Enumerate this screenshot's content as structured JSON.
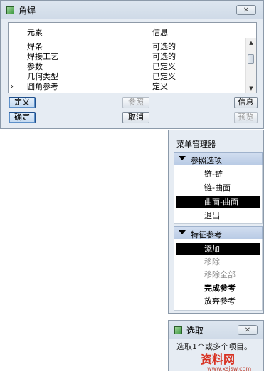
{
  "dialog": {
    "title": "角焊",
    "columns": [
      "元素",
      "信息"
    ],
    "rows": [
      {
        "element": "焊条",
        "info": "可选的",
        "marker": ""
      },
      {
        "element": "焊接工艺",
        "info": "可选的",
        "marker": ""
      },
      {
        "element": "参数",
        "info": "已定义",
        "marker": ""
      },
      {
        "element": "几何类型",
        "info": "已定义",
        "marker": ""
      },
      {
        "element": "圆角参考",
        "info": "定义",
        "marker": "›"
      }
    ],
    "buttons": {
      "define": "定义",
      "reference": "参照",
      "info": "信息",
      "ok": "确定",
      "cancel": "取消",
      "preview": "预览"
    },
    "close_glyph": "✕"
  },
  "menu_manager": {
    "title": "菜单管理器",
    "sections": [
      {
        "label": "参照选项",
        "items": [
          "链-链",
          "链-曲面",
          "曲面-曲面",
          "退出"
        ]
      },
      {
        "label": "特征参考",
        "items": [
          "添加",
          "移除",
          "移除全部",
          "完成参考",
          "放弃参考"
        ]
      }
    ]
  },
  "select_dialog": {
    "title": "选取",
    "text": "选取1个或多个项目。",
    "close_glyph": "✕"
  },
  "watermark": {
    "main": "资料网",
    "sub": "www.xsjsw.com"
  }
}
